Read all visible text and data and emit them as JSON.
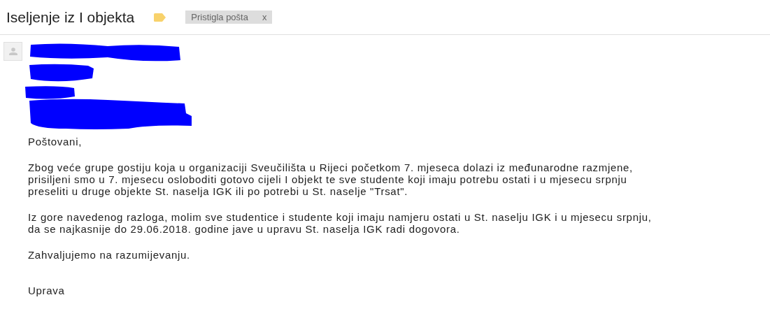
{
  "subject": "Iseljenje iz I objekta",
  "label": {
    "text": "Pristigla pošta",
    "remove": "x"
  },
  "body": [
    {
      "lines": [
        "Poštovani,"
      ]
    },
    {
      "lines": [
        "Zbog veće grupe gostiju koja u organizaciji Sveučilišta u Rijeci početkom 7. mjeseca dolazi iz međunarodne razmjene,",
        "prisiljeni smo u 7. mjesecu osloboditi gotovo cijeli I objekt te sve studente koji imaju potrebu ostati i u mjesecu srpnju",
        "preseliti u druge objekte St. naselja IGK ili po potrebi u St. naselje \"Trsat\"."
      ]
    },
    {
      "lines": [
        "Iz gore navedenog razloga, molim sve studentice i studente koji imaju namjeru ostati u St. naselju IGK i u mjesecu srpnju,",
        "da se najkasnije do 29.06.2018. godine jave u upravu St. naselja IGK radi dogovora."
      ]
    },
    {
      "lines": [
        "Zahvaljujemo na razumijevanju."
      ]
    }
  ],
  "signature": "Uprava"
}
